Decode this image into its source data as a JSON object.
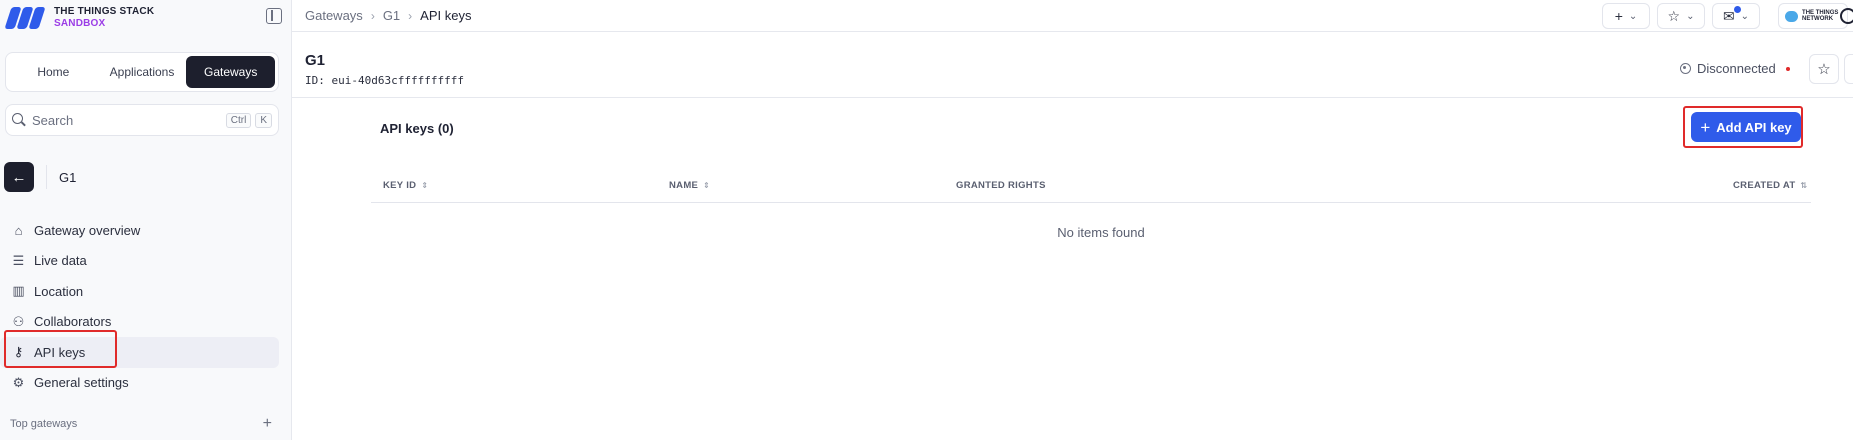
{
  "brand": {
    "line1": "THE THINGS STACK",
    "line2": "SANDBOX"
  },
  "switcher": {
    "tabs": [
      "Home",
      "Applications",
      "Gateways"
    ],
    "active": "Gateways"
  },
  "search": {
    "placeholder": "Search",
    "shortcut_1": "Ctrl",
    "shortcut_2": "K"
  },
  "entity": {
    "name": "G1"
  },
  "nav": {
    "items": [
      {
        "label": "Gateway overview",
        "icon": "router-icon"
      },
      {
        "label": "Live data",
        "icon": "list-icon"
      },
      {
        "label": "Location",
        "icon": "map-icon"
      },
      {
        "label": "Collaborators",
        "icon": "users-icon"
      },
      {
        "label": "API keys",
        "icon": "key-icon",
        "active": true
      },
      {
        "label": "General settings",
        "icon": "gear-icon"
      }
    ]
  },
  "top_gateways": {
    "label": "Top gateways"
  },
  "breadcrumb": {
    "items": [
      "Gateways",
      "G1",
      "API keys"
    ]
  },
  "header": {
    "title": "G1",
    "id_label": "ID:",
    "id_value": "eui-40d63cffffffffff",
    "status": "Disconnected",
    "status_color": "#e02a2a"
  },
  "topbar": {
    "ttn_logo_text": "THE THINGS NETWORK"
  },
  "content": {
    "title": "API keys (0)",
    "add_button": "Add API key",
    "accent_color": "#2f5bea",
    "columns": [
      "KEY ID",
      "NAME",
      "GRANTED RIGHTS",
      "CREATED AT"
    ],
    "empty_text": "No items found"
  }
}
